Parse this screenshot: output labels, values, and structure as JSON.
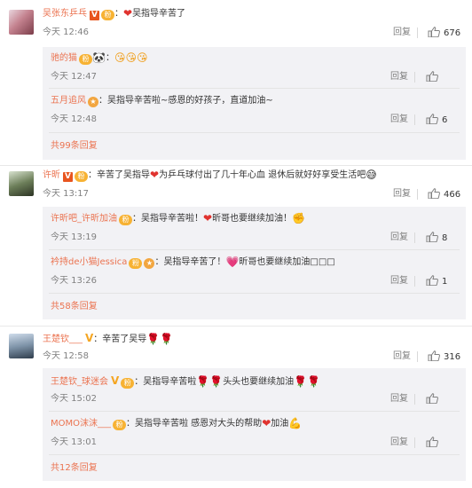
{
  "actions": {
    "reply": "回复"
  },
  "comments": [
    {
      "user": "吴张东乒乓",
      "text": "吴指导辛苦了",
      "time": "今天 12:46",
      "likes": "676",
      "replies": [
        {
          "user": "驰的猫",
          "text": "",
          "time": "今天 12:47",
          "likes": ""
        },
        {
          "user": "五月追风",
          "text": "吴指导辛苦啦~感恩的好孩子，直道加油~",
          "time": "今天 12:48",
          "likes": "6"
        }
      ],
      "more": "共99条回复"
    },
    {
      "user": "许昕",
      "text": "辛苦了吴指导",
      "text2": "为乒乓球付出了几十年心血 退休后就好好享受生活吧",
      "time": "今天 13:17",
      "likes": "466",
      "replies": [
        {
          "user": "许昕吧_许昕加油",
          "text": "吴指导辛苦啦！",
          "text2": "昕哥也要继续加油！",
          "time": "今天 13:19",
          "likes": "8"
        },
        {
          "user": "衿持de小猫Jessica",
          "text": "吴指导辛苦了！",
          "text2": "昕哥也要继续加油□□□",
          "time": "今天 13:26",
          "likes": "1"
        }
      ],
      "more": "共58条回复"
    },
    {
      "user": "王楚钦___",
      "text": "辛苦了吴导",
      "time": "今天 12:58",
      "likes": "316",
      "replies": [
        {
          "user": "王楚钦_球迷会",
          "text": "吴指导辛苦啦",
          "text2": "头头也要继续加油",
          "time": "今天 15:02",
          "likes": ""
        },
        {
          "user": "MOMO沫沫___",
          "text": "吴指导辛苦啦 感恩对大头的帮助",
          "text2": "加油",
          "time": "今天 13:01",
          "likes": ""
        }
      ],
      "more": "共12条回复"
    }
  ]
}
